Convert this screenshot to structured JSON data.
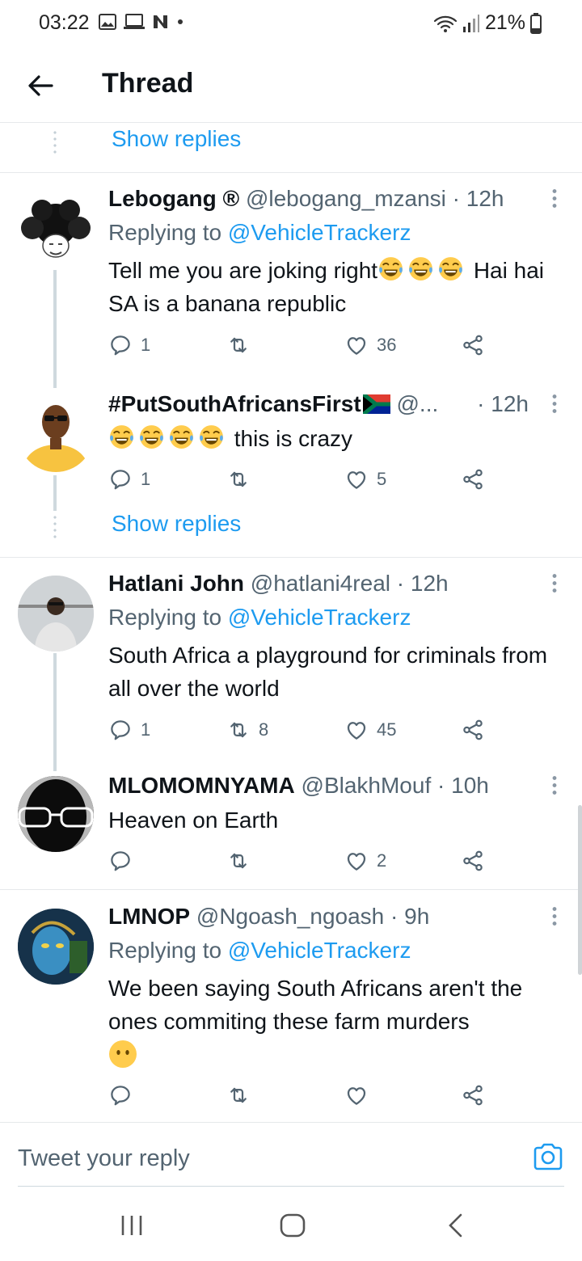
{
  "status_bar": {
    "time": "03:22",
    "battery": "21%"
  },
  "header": {
    "title": "Thread"
  },
  "show_replies_label": "Show replies",
  "tweets": [
    {
      "name": "Lebogang ®",
      "handle": "@lebogang_mzansi",
      "time": "· 12h",
      "replying_prefix": "Replying to ",
      "replying_to": "@VehicleTrackerz",
      "text_a": "Tell me you are joking right",
      "text_b": " Hai hai SA is a banana republic",
      "replies": "1",
      "retweets": "",
      "likes": "36"
    },
    {
      "name": "#PutSouthAfricansFirst",
      "handle": "@...",
      "time": "· 12h",
      "text": "this is crazy",
      "replies": "1",
      "retweets": "",
      "likes": "5"
    },
    {
      "name": "Hatlani John",
      "handle": "@hatlani4real",
      "time": "· 12h",
      "replying_prefix": "Replying to ",
      "replying_to": "@VehicleTrackerz",
      "text": "South Africa a playground for criminals from all over the world",
      "replies": "1",
      "retweets": "8",
      "likes": "45"
    },
    {
      "name": "MLOMOMNYAMA",
      "handle": "@BlakhMouf",
      "time": "· 10h",
      "text": "Heaven on Earth",
      "replies": "",
      "retweets": "",
      "likes": "2"
    },
    {
      "name": "LMNOP",
      "handle": "@Ngoash_ngoash",
      "time": "· 9h",
      "replying_prefix": "Replying to ",
      "replying_to": "@VehicleTrackerz",
      "text": "We been saying South Africans aren't the ones commiting these farm murders",
      "replies": "",
      "retweets": "",
      "likes": ""
    }
  ],
  "compose": {
    "placeholder": "Tweet your reply"
  },
  "colors": {
    "link_blue": "#1d9bf0",
    "secondary_text": "#536471",
    "divider": "#e6e9eb"
  },
  "icons": [
    "back-arrow-icon",
    "more-icon",
    "reply-icon",
    "retweet-icon",
    "like-icon",
    "share-icon",
    "camera-icon"
  ]
}
